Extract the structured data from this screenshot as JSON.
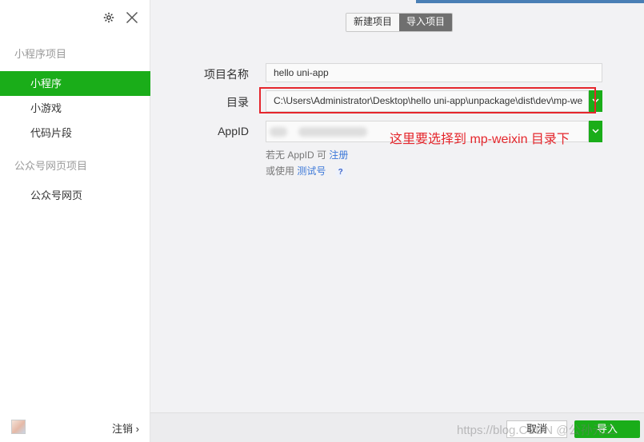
{
  "sidebar": {
    "miniprogram_section": "小程序项目",
    "items": [
      {
        "label": "小程序",
        "active": true
      },
      {
        "label": "小游戏",
        "active": false
      },
      {
        "label": "代码片段",
        "active": false
      }
    ],
    "official_section": "公众号网页项目",
    "official_items": [
      {
        "label": "公众号网页"
      }
    ],
    "logout_label": "注销 ›"
  },
  "tabs": {
    "new_project": "新建项目",
    "import_project": "导入项目",
    "active": "import_project"
  },
  "form": {
    "name_label": "项目名称",
    "name_value": "hello uni-app",
    "dir_label": "目录",
    "dir_value": "C:\\Users\\Administrator\\Desktop\\hello uni-app\\unpackage\\dist\\dev\\mp-we",
    "appid_label": "AppID",
    "appid_value_obscured": true,
    "hint1_prefix": "若无 AppID 可",
    "hint1_link": "注册",
    "hint2_prefix": "或使用",
    "hint2_link": "测试号",
    "help_glyph": "?"
  },
  "annotation": {
    "text": "这里要选择到 mp-weixin 目录下",
    "color": "#e4262c"
  },
  "buttons": {
    "cancel": "取消",
    "import": "导入"
  },
  "watermark": "https://blog.CSDN @公孙元二",
  "colors": {
    "accent_green": "#1aad19",
    "highlight_red": "#e5262d",
    "link_blue": "#3c78d8"
  }
}
